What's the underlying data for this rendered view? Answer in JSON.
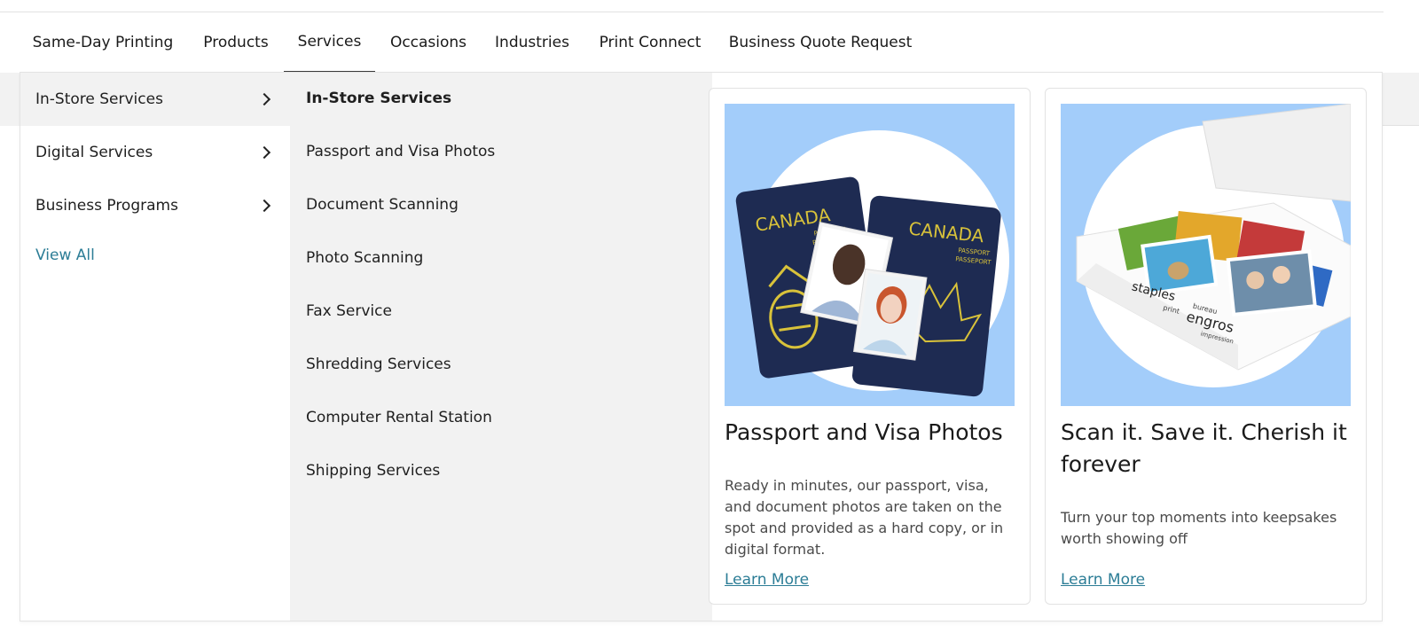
{
  "nav": {
    "items": [
      {
        "label": "Same-Day Printing"
      },
      {
        "label": "Products"
      },
      {
        "label": "Services"
      },
      {
        "label": "Occasions"
      },
      {
        "label": "Industries"
      },
      {
        "label": "Print Connect"
      },
      {
        "label": "Business Quote Request"
      }
    ],
    "active": "Services"
  },
  "categories": {
    "items": [
      {
        "label": "In-Store Services"
      },
      {
        "label": "Digital Services"
      },
      {
        "label": "Business Programs"
      }
    ],
    "selected": "In-Store Services",
    "view_all": "View All"
  },
  "services": {
    "heading": "In-Store Services",
    "items": [
      {
        "label": "Passport and Visa Photos"
      },
      {
        "label": "Document Scanning"
      },
      {
        "label": "Photo Scanning"
      },
      {
        "label": "Fax Service"
      },
      {
        "label": "Shredding Services"
      },
      {
        "label": "Computer Rental Station"
      },
      {
        "label": "Shipping Services"
      }
    ]
  },
  "cards": [
    {
      "title": "Passport and Visa Photos",
      "description": "Ready in minutes, our passport, visa, and document photos are taken on the spot and provided as a hard copy, or in digital format.",
      "link": "Learn More",
      "image_text": {
        "country": "CANADA",
        "sub1": "PASSPORT",
        "sub2": "PASSEPORT"
      }
    },
    {
      "title": "Scan it. Save it. Cherish it forever",
      "description": "Turn your top moments into keepsakes worth showing off",
      "link": "Learn More",
      "image_text": {
        "brand1": "staples",
        "brand1_sub": "print",
        "brand2_top": "bureau",
        "brand2": "engros",
        "brand2_sub": "impression"
      }
    }
  ],
  "colors": {
    "accent_link": "#2c7d96",
    "card_image_bg": "#a3cdfa",
    "panel_bg": "#f2f2f2",
    "passport_blue": "#1e2b52",
    "passport_gold": "#d8c23a"
  }
}
